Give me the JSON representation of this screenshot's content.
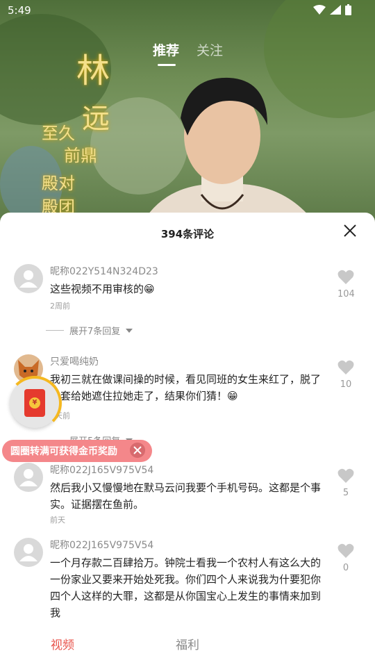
{
  "status": {
    "time": "5:49"
  },
  "top_tabs": {
    "recommend": "推荐",
    "follow": "关注"
  },
  "video_overlay": {
    "calligraphy_lines": [
      "至久",
      "前鼎",
      "殿对",
      "殿团"
    ]
  },
  "sheet": {
    "title": "394条评论"
  },
  "comments": [
    {
      "user": "昵称022Y514N324D23",
      "text": "这些视频不用审核的😁",
      "time": "2周前",
      "likes": "104",
      "replies": "展开7条回复"
    },
    {
      "user": "只爱喝纯奶",
      "text": "我初三就在做课间操的时候，看见同班的女生来红了，脱了外套给她遮住拉她走了，结果你们猜！😁",
      "time": "5天前",
      "likes": "10",
      "replies": "展开5条回复"
    },
    {
      "user": "昵称022J165V975V54",
      "text": "然后我小又慢慢地在默马云问我要个手机号码。这都是个事实。证据摆在鱼前。",
      "time": "前天",
      "likes": "5"
    },
    {
      "user": "昵称022J165V975V54",
      "text": "一个月存款二百肆拾万。钟院士看我一个农村人有这么大的一份家业又要来开始处死我。你们四个人来说我为什要犯你四个人这样的大罪，这都是从你国宝心上发生的事情来加到我",
      "likes": "0"
    }
  ],
  "reward": {
    "banner": "圆圈转满可获得金币奖励",
    "coin_symbol": "¥"
  },
  "bottom_nav": {
    "video": "视频",
    "welfare": "福利"
  },
  "colors": {
    "accent": "#e8534b",
    "banner": "#f4878a",
    "ring": "#f5b820"
  }
}
